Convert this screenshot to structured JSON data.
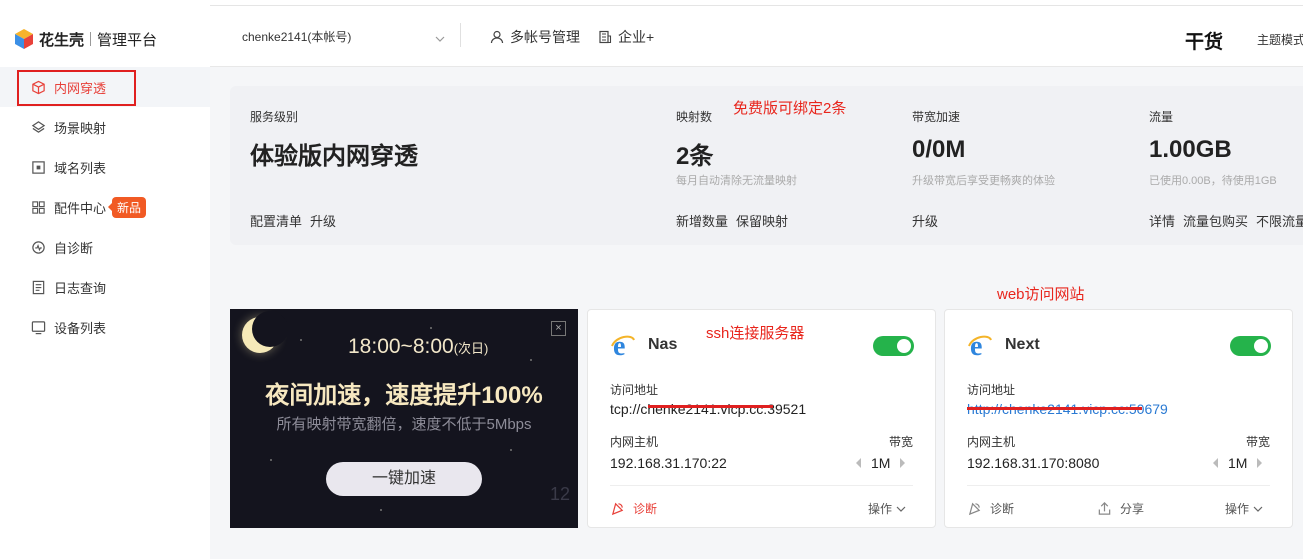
{
  "brand": {
    "name": "花生壳",
    "subtitle": "管理平台"
  },
  "sidebar": {
    "items": [
      {
        "label": "内网穿透",
        "icon": "cube-icon",
        "active": true
      },
      {
        "label": "场景映射",
        "icon": "layers-icon"
      },
      {
        "label": "域名列表",
        "icon": "domain-icon"
      },
      {
        "label": "配件中心",
        "icon": "grid-icon",
        "badge": "新品"
      },
      {
        "label": "自诊断",
        "icon": "diagnose-icon"
      },
      {
        "label": "日志查询",
        "icon": "log-icon"
      },
      {
        "label": "设备列表",
        "icon": "monitor-icon"
      }
    ]
  },
  "header": {
    "account": "chenke2141(本帐号)",
    "multi_account": "多帐号管理",
    "enterprise": "企业+",
    "ganhuo": "干货",
    "theme": "主题模式"
  },
  "stats": {
    "service": {
      "label": "服务级别",
      "value": "体验版内网穿透",
      "actions": [
        "配置清单",
        "升级"
      ]
    },
    "mappings": {
      "label": "映射数",
      "value": "2条",
      "sub": "每月自动清除无流量映射",
      "actions": [
        "新增数量",
        "保留映射"
      ]
    },
    "bandwidth": {
      "label": "带宽加速",
      "value": "0/0M",
      "sub": "升级带宽后享受更畅爽的体验",
      "actions": [
        "升级"
      ]
    },
    "traffic": {
      "label": "流量",
      "value": "1.00GB",
      "sub": "已使用0.00B，待使用1GB",
      "actions": [
        "详情",
        "流量包购买",
        "不限流量"
      ]
    }
  },
  "annotations": {
    "free_bind": "免费版可绑定2条",
    "web": "web访问网站",
    "ssh": "ssh连接服务器"
  },
  "promo": {
    "time": "18:00~8:00",
    "time_suffix": "(次日)",
    "title": "夜间加速，速度提升100%",
    "subtitle": "所有映射带宽翻倍，速度不低于5Mbps",
    "button": "一键加速",
    "close": "×",
    "corner_number": "12"
  },
  "cards": [
    {
      "name": "Nas",
      "enabled": true,
      "address_label": "访问地址",
      "address": "tcp://chenke2141.vicp.cc:39521",
      "host_label": "内网主机",
      "host": "192.168.31.170:22",
      "bandwidth_label": "带宽",
      "bandwidth": "1M",
      "diagnose": "诊断",
      "operate": "操作"
    },
    {
      "name": "Next",
      "enabled": true,
      "address_label": "访问地址",
      "address": "http://chenke2141.vicp.cc:50679",
      "host_label": "内网主机",
      "host": "192.168.31.170:8080",
      "bandwidth_label": "带宽",
      "bandwidth": "1M",
      "diagnose": "诊断",
      "share": "分享",
      "operate": "操作"
    }
  ],
  "colors": {
    "accent": "#e8413a",
    "toggle_on": "#25b34b",
    "annotation": "#e8251c",
    "link": "#2a7ad3"
  }
}
